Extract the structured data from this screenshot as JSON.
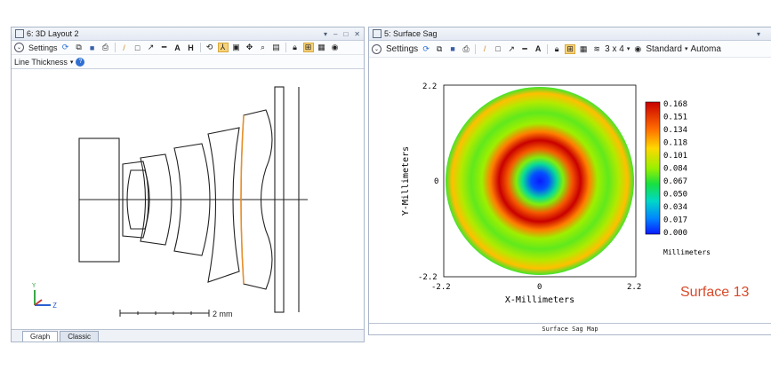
{
  "layout_window": {
    "title": "6: 3D Layout 2",
    "controls": [
      "▾",
      "–",
      "□",
      "✕"
    ],
    "toolbar_settings": "Settings",
    "line_thickness": "Line Thickness",
    "scale_label": "2 mm",
    "tabs": [
      "Graph",
      "Classic"
    ],
    "axis_labels": {
      "y": "Y",
      "z": "Z"
    }
  },
  "sag_window": {
    "title": "5: Surface Sag",
    "pin": "▾",
    "toolbar_settings": "Settings",
    "grid_size": "3 x 4",
    "standard": "Standard",
    "automatic": "Automa",
    "footer": "Surface Sag Map",
    "x_axis_label": "X-Millimeters",
    "y_axis_label": "Y-Millimeters",
    "colorbar_unit": "Millimeters",
    "surface_label": "Surface 13",
    "surface_label_color": "#d94a2a"
  },
  "chart_data": {
    "type": "heatmap",
    "title": "Surface Sag Map",
    "xlabel": "X-Millimeters",
    "ylabel": "Y-Millimeters",
    "xlim": [
      -2.2,
      2.2
    ],
    "ylim": [
      -2.2,
      2.2
    ],
    "x_ticks": [
      "-2.2",
      "0",
      "2.2"
    ],
    "y_ticks": [
      "2.2",
      "0",
      "-2.2"
    ],
    "colorbar_ticks": [
      "0.168",
      "0.151",
      "0.134",
      "0.118",
      "0.101",
      "0.084",
      "0.067",
      "0.050",
      "0.034",
      "0.017",
      "0.000"
    ],
    "colorbar_unit": "Millimeters",
    "zlim": [
      0.0,
      0.168
    ],
    "radial_profile": [
      {
        "r": 0.0,
        "sag": 0.0
      },
      {
        "r": 0.2,
        "sag": 0.01
      },
      {
        "r": 0.4,
        "sag": 0.05
      },
      {
        "r": 0.55,
        "sag": 0.08
      },
      {
        "r": 0.75,
        "sag": 0.14
      },
      {
        "r": 0.95,
        "sag": 0.168
      },
      {
        "r": 1.15,
        "sag": 0.13
      },
      {
        "r": 1.35,
        "sag": 0.085
      },
      {
        "r": 1.6,
        "sag": 0.075
      },
      {
        "r": 1.85,
        "sag": 0.09
      },
      {
        "r": 2.05,
        "sag": 0.115
      },
      {
        "r": 2.2,
        "sag": 0.07
      }
    ]
  }
}
